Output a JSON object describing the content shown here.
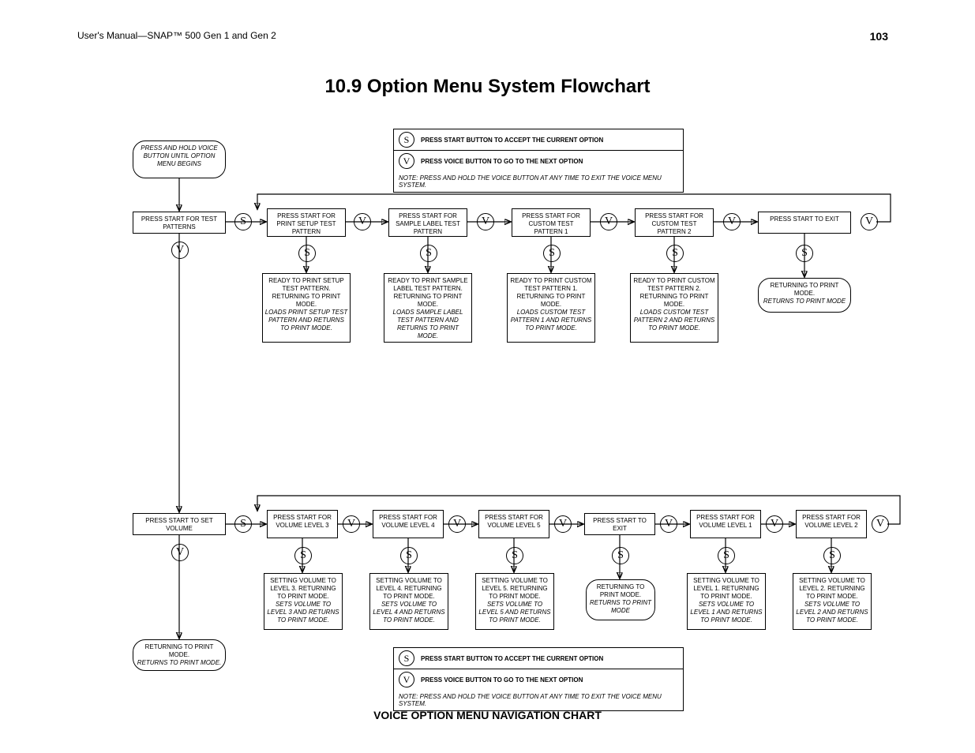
{
  "header_left": "User's Manual—SNAP™ 500 Gen 1 and Gen 2",
  "header_right": "103",
  "title": "10.9 Option Menu System Flowchart",
  "footer": "VOICE OPTION MENU NAVIGATION CHART",
  "legend": {
    "s": "S",
    "v": "V",
    "s_text": "PRESS START BUTTON TO ACCEPT THE CURRENT OPTION",
    "v_text": "PRESS VOICE BUTTON TO GO TO THE NEXT OPTION",
    "note": "NOTE: PRESS AND HOLD THE VOICE BUTTON AT ANY TIME TO EXIT THE VOICE MENU SYSTEM."
  },
  "start_pill": "PRESS AND HOLD VOICE BUTTON UNTIL OPTION MENU BEGINS",
  "row1": {
    "b0": "PRESS START FOR TEST PATTERNS",
    "b1": "PRESS START FOR PRINT SETUP TEST PATTERN",
    "b2": "PRESS START FOR SAMPLE LABEL TEST PATTERN",
    "b3": "PRESS  START FOR CUSTOM TEST PATTERN 1",
    "b4": "PRESS START FOR CUSTOM TEST PATTERN 2",
    "b5": "PRESS START TO EXIT"
  },
  "row1d": {
    "d1a": "READY TO PRINT SETUP TEST PATTERN. RETURNING TO PRINT MODE.",
    "d1b": "LOADS PRINT SETUP TEST PATTERN AND RETURNS TO PRINT MODE.",
    "d2a": "READY TO PRINT SAMPLE LABEL TEST PATTERN. RETURNING TO PRINT MODE.",
    "d2b": "LOADS SAMPLE LABEL TEST PATTERN AND RETURNS TO PRINT MODE.",
    "d3a": "READY TO PRINT CUSTOM TEST PATTERN 1. RETURNING TO PRINT MODE.",
    "d3b": "LOADS CUSTOM TEST PATTERN 1 AND RETURNS TO PRINT MODE.",
    "d4a": "READY TO PRINT CUSTOM TEST PATTERN 2. RETURNING TO PRINT MODE.",
    "d4b": "LOADS CUSTOM TEST PATTERN 2 AND RETURNS TO PRINT MODE.",
    "exit_a": "RETURNING TO PRINT MODE.",
    "exit_b": "RETURNS TO PRINT MODE"
  },
  "row2": {
    "b0": "PRESS START TO SET VOLUME",
    "b1": "PRESS START FOR VOLUME LEVEL 3",
    "b2": "PRESS START FOR VOLUME LEVEL 4",
    "b3": "PRESS START FOR VOLUME LEVEL 5",
    "b4": "PRESS START TO EXIT",
    "b5": "PRESS START FOR VOLUME LEVEL 1",
    "b6": "PRESS START FOR VOLUME LEVEL 2"
  },
  "row2d": {
    "d1a": "SETTING VOLUME TO LEVEL 3. RETURNING TO PRINT MODE.",
    "d1b": "SETS VOLUME TO LEVEL 3 AND RETURNS TO PRINT MODE.",
    "d2a": "SETTING VOLUME TO LEVEL 4. RETURNING TO PRINT MODE.",
    "d2b": "SETS VOLUME TO LEVEL 4 AND RETURNS TO PRINT MODE.",
    "d3a": "SETTING VOLUME TO LEVEL 5. RETURNING TO PRINT MODE.",
    "d3b": "SETS VOLUME TO LEVEL 5 AND RETURNS TO PRINT MODE.",
    "d4a": "RETURNING TO PRINT MODE.",
    "d4b": "RETURNS TO PRINT MODE",
    "d5a": "SETTING VOLUME TO LEVEL 1. RETURNING TO PRINT MODE.",
    "d5b": "SETS VOLUME TO LEVEL 1 AND RETURNS TO PRINT MODE.",
    "d6a": "SETTING VOLUME TO LEVEL 2. RETURNING TO PRINT MODE.",
    "d6b": "SETS VOLUME TO LEVEL 2 AND RETURNS TO PRINT MODE."
  },
  "row3": {
    "a": "RETURNING TO PRINT MODE.",
    "b": "RETURNS TO PRINT MODE."
  },
  "letters": {
    "s": "S",
    "v": "V"
  }
}
